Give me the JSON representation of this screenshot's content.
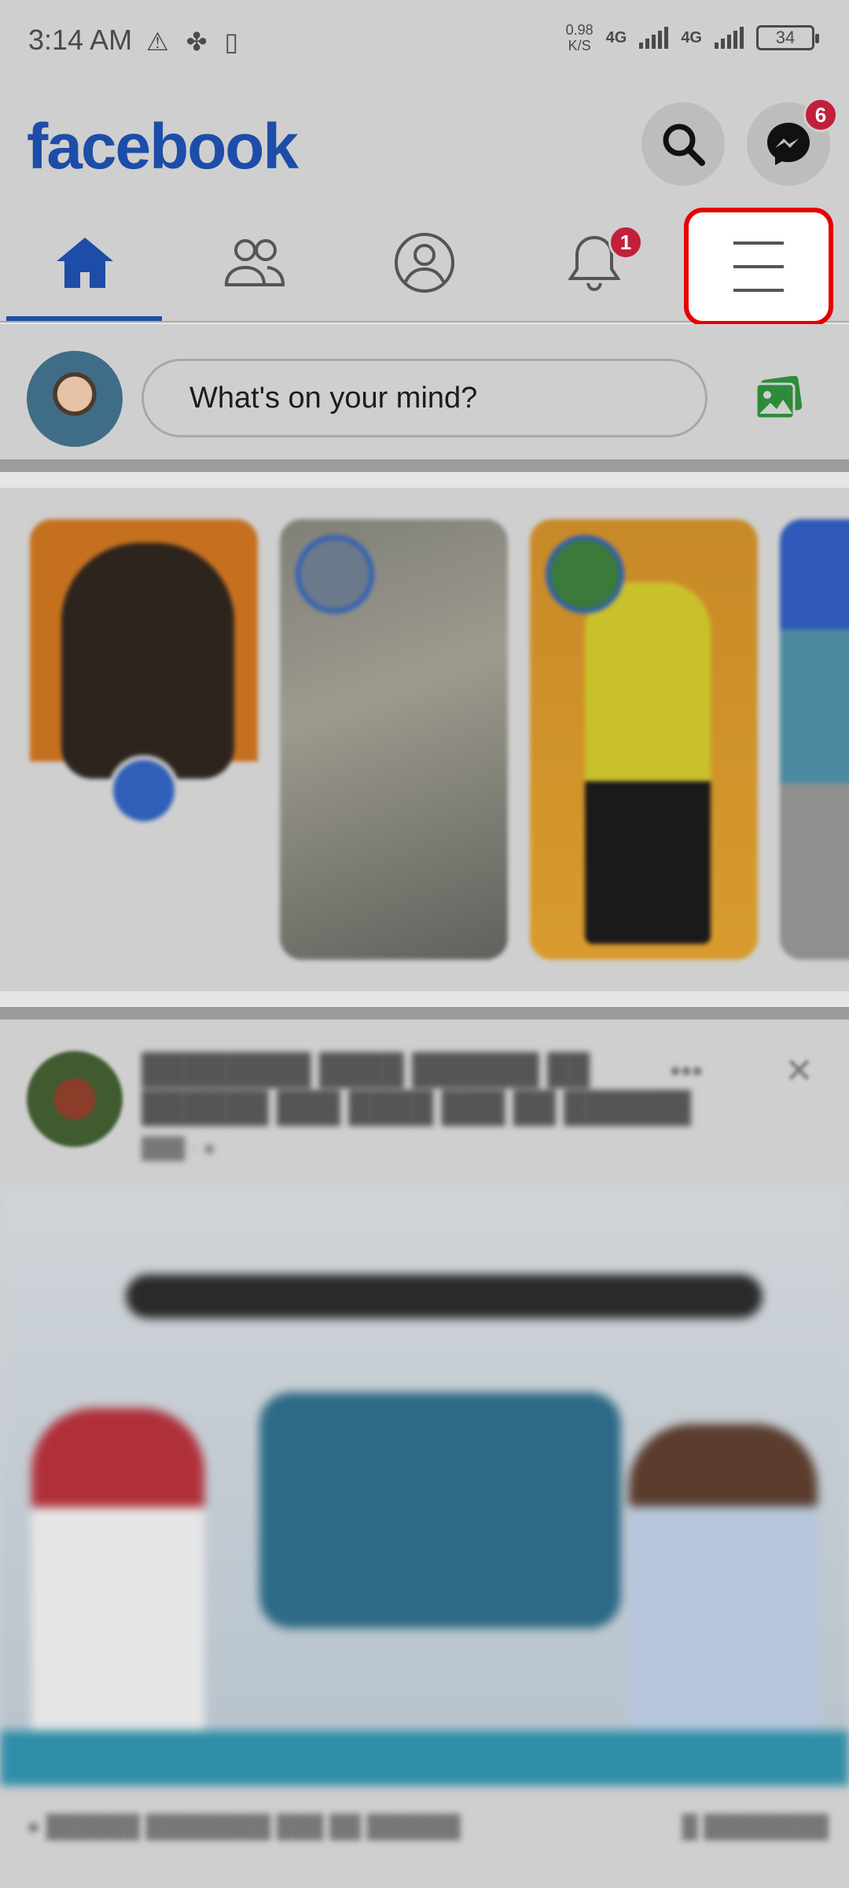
{
  "status_bar": {
    "time": "3:14 AM",
    "left_icons": [
      "warning-icon",
      "fan-icon",
      "clipboard-icon"
    ],
    "net_speed_value": "0.98",
    "net_speed_unit": "K/S",
    "network_1": "4G",
    "network_2": "4G",
    "battery": "34"
  },
  "header": {
    "logo": "facebook",
    "messenger_badge": "6"
  },
  "nav": {
    "tabs": [
      {
        "name": "home",
        "icon": "home-icon",
        "active": true
      },
      {
        "name": "friends",
        "icon": "friends-icon"
      },
      {
        "name": "profile",
        "icon": "profile-icon"
      },
      {
        "name": "notifications",
        "icon": "bell-icon",
        "badge": "1"
      },
      {
        "name": "menu",
        "icon": "hamburger-menu-icon",
        "highlighted": true
      }
    ]
  },
  "composer": {
    "placeholder": "What's on your mind?"
  },
  "colors": {
    "brand": "#1d4da8",
    "badge": "#c2203a",
    "highlight": "#e60000",
    "photo_icon": "#2e8b3a"
  }
}
